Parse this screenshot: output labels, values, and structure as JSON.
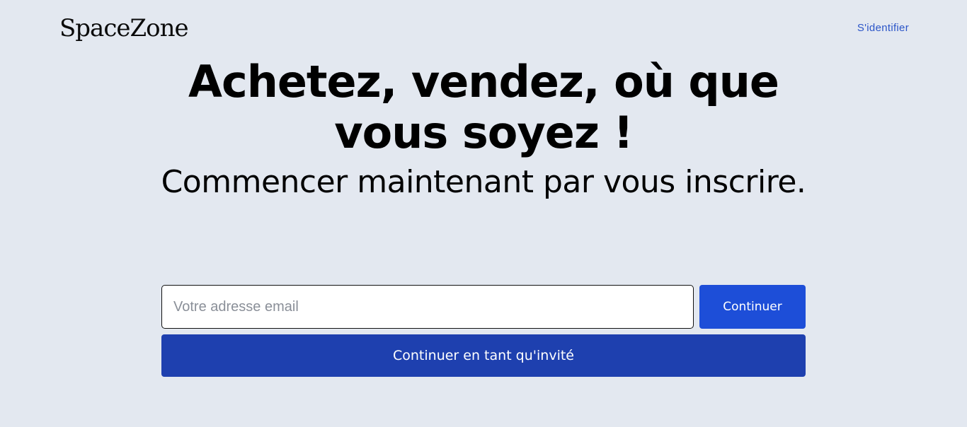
{
  "brand": {
    "name": "SpaceZone"
  },
  "nav": {
    "signin_label": "S'identifier"
  },
  "hero": {
    "title": "Achetez, vendez, où que vous soyez !",
    "subtitle": "Commencer maintenant par vous inscrire."
  },
  "form": {
    "email_placeholder": "Votre adresse email",
    "email_value": "",
    "continue_label": "Continuer",
    "guest_label": "Continuer en tant qu'invité"
  },
  "colors": {
    "background": "#e3e8f0",
    "primary": "#1d4ed8",
    "primary_dark": "#1e40af",
    "link": "#2b55c8"
  }
}
